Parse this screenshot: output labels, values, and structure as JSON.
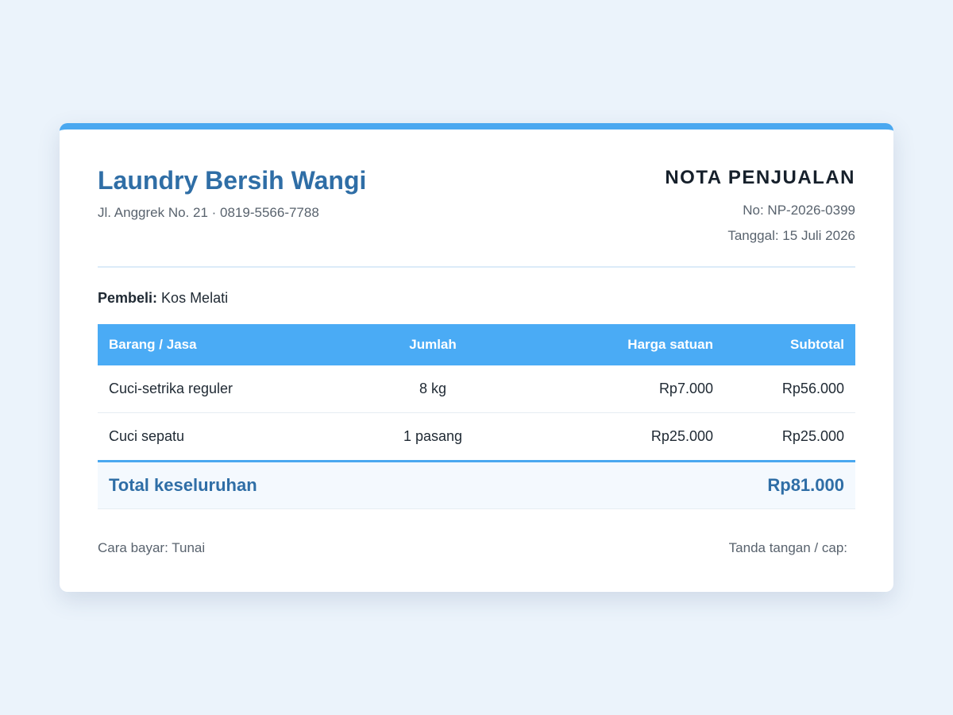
{
  "store": {
    "name": "Laundry Bersih Wangi",
    "info": "Jl. Anggrek No. 21 · 0819-5566-7788"
  },
  "document": {
    "title": "NOTA PENJUALAN",
    "number": "No: NP-2026-0399",
    "date": "Tanggal: 15 Juli 2026"
  },
  "buyer": {
    "label": "Pembeli:",
    "name": "Kos Melati"
  },
  "table": {
    "headers": {
      "item": "Barang / Jasa",
      "qty": "Jumlah",
      "price": "Harga satuan",
      "subtotal": "Subtotal"
    },
    "rows": [
      {
        "item": "Cuci-setrika reguler",
        "qty": "8 kg",
        "price": "Rp7.000",
        "subtotal": "Rp56.000"
      },
      {
        "item": "Cuci sepatu",
        "qty": "1 pasang",
        "price": "Rp25.000",
        "subtotal": "Rp25.000"
      }
    ],
    "total_label": "Total keseluruhan",
    "total_value": "Rp81.000"
  },
  "footer": {
    "payment": "Cara bayar: Tunai",
    "signature": "Tanda tangan / cap:"
  },
  "colors": {
    "accent": "#4aa8f0",
    "brand_text": "#2f6ea6",
    "background": "#ebf3fb"
  }
}
